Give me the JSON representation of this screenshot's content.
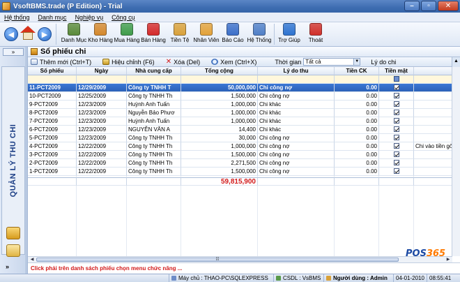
{
  "window": {
    "title": "VsoftBMS.trade (P Edition) - Trial"
  },
  "menu": [
    "Hệ thống",
    "Danh mục",
    "Nghiệp vụ",
    "Công cụ"
  ],
  "toolbar": {
    "items": [
      {
        "label": "Danh Mục",
        "icon": "catalog-icon",
        "color": "#5a8a3a"
      },
      {
        "label": "Kho Hàng",
        "icon": "warehouse-box-icon",
        "color": "#d4882c"
      },
      {
        "label": "Mua Hàng",
        "icon": "purchase-icon",
        "color": "#3f9c4a"
      },
      {
        "label": "Bán Hàng",
        "icon": "sales-icon",
        "color": "#d42a2a"
      },
      {
        "label": "Tiền Tệ",
        "icon": "money-icon",
        "color": "#d9a13a"
      },
      {
        "label": "Nhân Viên",
        "icon": "employee-icon",
        "color": "#e2a23a"
      },
      {
        "label": "Báo Cáo",
        "icon": "report-icon",
        "color": "#3b6fc9"
      },
      {
        "label": "Hệ Thống",
        "icon": "system-icon",
        "color": "#4f7fc7"
      },
      {
        "label": "Trợ Giúp",
        "icon": "help-icon",
        "color": "#2d73d0"
      },
      {
        "label": "Thoát",
        "icon": "exit-icon",
        "color": "#d0302a"
      }
    ]
  },
  "sidebar": {
    "toggle": "»",
    "vertical_title": "QUẢN LÝ THU CHI",
    "bottom_arrow": "»"
  },
  "panel": {
    "title": "Sổ phiếu chi"
  },
  "actions": {
    "new": "Thêm mới (Ctrl+T)",
    "edit": "Hiệu chỉnh (F6)",
    "delete": "Xóa (Del)",
    "view": "Xem (Ctrl+X)",
    "time_label": "Thời gian",
    "time_value": "Tất cả",
    "reason_label": "Lý do chi"
  },
  "grid": {
    "columns": [
      "Số phiếu",
      "Ngày",
      "Nhà cung cấp",
      "Tổng cộng",
      "Lý do thu",
      "Tiền CK",
      "Tiền mặt",
      ""
    ],
    "rows": [
      {
        "no": "11-PCT2009",
        "date": "12/29/2009",
        "supplier": "Công ty TNHH T",
        "total": "50,000,000",
        "reason": "Chi công nợ",
        "ck": "0.00",
        "cash": true,
        "note": "",
        "selected": true
      },
      {
        "no": "10-PCT2009",
        "date": "12/25/2009",
        "supplier": "Công ty TNHH Th",
        "total": "1,500,000",
        "reason": "Chi công nợ",
        "ck": "0.00",
        "cash": true,
        "note": ""
      },
      {
        "no": "9-PCT2009",
        "date": "12/23/2009",
        "supplier": "Huỳnh Anh Tuấn",
        "total": "1,000,000",
        "reason": "Chi khác",
        "ck": "0.00",
        "cash": true,
        "note": ""
      },
      {
        "no": "8-PCT2009",
        "date": "12/23/2009",
        "supplier": "Nguyễn Bảo Phươ",
        "total": "1,000,000",
        "reason": "Chi khác",
        "ck": "0.00",
        "cash": true,
        "note": ""
      },
      {
        "no": "7-PCT2009",
        "date": "12/23/2009",
        "supplier": "Huỳnh Anh Tuấn",
        "total": "1,000,000",
        "reason": "Chi khác",
        "ck": "0.00",
        "cash": true,
        "note": ""
      },
      {
        "no": "6-PCT2009",
        "date": "12/23/2009",
        "supplier": "NGUYỄN VĂN A",
        "total": "14,400",
        "reason": "Chi khác",
        "ck": "0.00",
        "cash": true,
        "note": ""
      },
      {
        "no": "5-PCT2009",
        "date": "12/23/2009",
        "supplier": "Công ty TNHH Th",
        "total": "30,000",
        "reason": "Chi công nợ",
        "ck": "0.00",
        "cash": true,
        "note": ""
      },
      {
        "no": "4-PCT2009",
        "date": "12/22/2009",
        "supplier": "Công ty TNHH Th",
        "total": "1,000,000",
        "reason": "Chi công nợ",
        "ck": "0.00",
        "cash": true,
        "note": "Chi vào tiền gố"
      },
      {
        "no": "3-PCT2009",
        "date": "12/22/2009",
        "supplier": "Công ty TNHH Th",
        "total": "1,500,000",
        "reason": "Chi công nợ",
        "ck": "0.00",
        "cash": true,
        "note": ""
      },
      {
        "no": "2-PCT2009",
        "date": "12/22/2009",
        "supplier": "Công ty TNHH Th",
        "total": "2,271,500",
        "reason": "Chi công nợ",
        "ck": "0.00",
        "cash": true,
        "note": ""
      },
      {
        "no": "1-PCT2009",
        "date": "12/22/2009",
        "supplier": "Công ty TNHH Th",
        "total": "1,500,000",
        "reason": "Chi công nợ",
        "ck": "0.00",
        "cash": true,
        "note": ""
      }
    ],
    "grand_total": "59,815,900"
  },
  "hint": "Click phải trên danh sách phiếu chọn menu chức năng ...",
  "logo": {
    "prefix": "POS",
    "suffix": "365"
  },
  "status": {
    "server": "Máy chủ : THAO-PC\\SQLEXPRESS",
    "db": "CSDL : VsBMS",
    "user": "Người dùng : Admin",
    "date": "04-01-2010",
    "time": "08:55:41"
  }
}
